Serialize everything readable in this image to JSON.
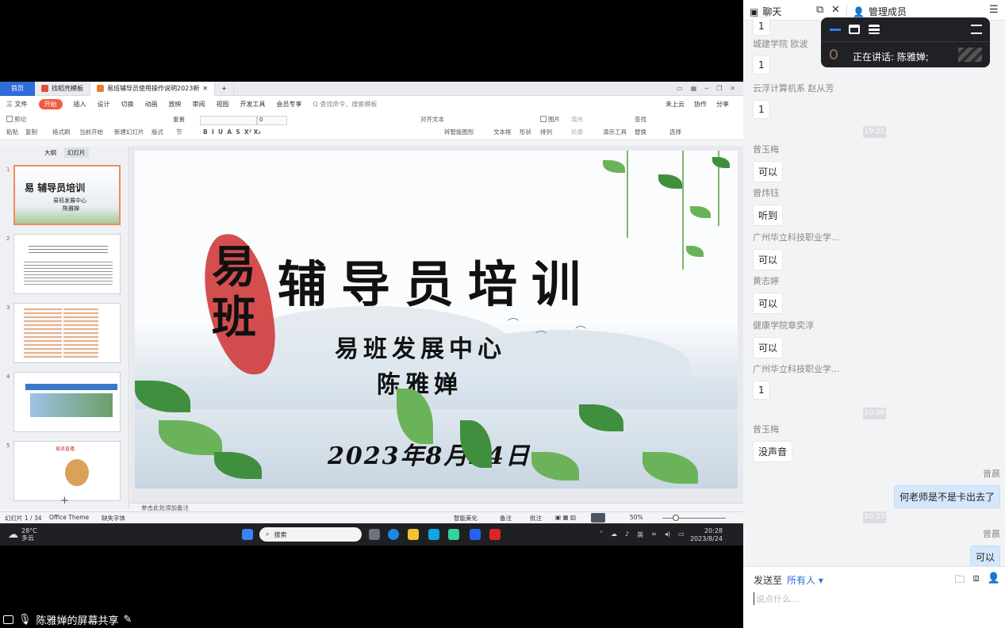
{
  "screen_share": {
    "label": "陈雅婵的屏幕共享",
    "wps": {
      "tabs": [
        "首页",
        "找稻壳模板",
        "易班辅导员使用操作说明2023新"
      ],
      "menu": [
        "三 文件",
        "开始",
        "插入",
        "设计",
        "切换",
        "动画",
        "放映",
        "审阅",
        "视图",
        "开发工具",
        "会员专享",
        "Q 查找命令、搜索模板"
      ],
      "menu_right": [
        "未上云",
        "协作",
        "分享"
      ],
      "ribbon": {
        "cut": "剪切",
        "paste": "粘贴",
        "copy": "复制",
        "painter": "格式刷",
        "play": "当前开始",
        "new_slide": "新建幻灯片",
        "layout": "版式",
        "section": "节",
        "reset": "重置",
        "font_size": "0",
        "align_text": "对齐文本",
        "smartart": "转智能图形",
        "textbox": "文本框",
        "shape": "形状",
        "picture": "图片",
        "arrange": "排列",
        "fill": "填充",
        "outline": "轮廓",
        "present": "演示工具",
        "find": "查找",
        "replace": "替换",
        "select": "选择"
      },
      "pane_tabs": [
        "大纲",
        "幻灯片"
      ],
      "thumb_numbers": [
        "1",
        "2",
        "3",
        "4",
        "5"
      ],
      "thumb_texts": {
        "t1_title": "易 辅导员培训",
        "t1_sub": "易班发展中心",
        "t1_name": "陈雅婵",
        "t5_title": "易班直播"
      },
      "slide": {
        "ban": "易 班",
        "title": "辅导员培训",
        "sub1": "易班发展中心",
        "sub2": "陈雅婵",
        "date": "2023年8月24日"
      },
      "notes_placeholder": "单击此处添加备注",
      "status": {
        "slide_count": "幻灯片 1 / 34",
        "theme": "Office Theme",
        "missing_font": "缺失字体",
        "beautify": "智能美化",
        "notes": "备注",
        "comments": "批注",
        "zoom": "50%"
      }
    },
    "taskbar": {
      "temp": "28°C",
      "weather": "多云",
      "search": "搜索",
      "lang": "英",
      "time": "20:28",
      "date": "2023/8/24"
    }
  },
  "chat": {
    "tab_chat": "聊天",
    "tab_members": "管理成员",
    "messages": [
      {
        "kind": "in",
        "name": "",
        "text": "1"
      },
      {
        "kind": "in",
        "name": "城建学院  欧波",
        "text": "1"
      },
      {
        "kind": "in",
        "name": "云浮计算机系  赵从芳",
        "text": "1"
      },
      {
        "kind": "time",
        "text": "19:21"
      },
      {
        "kind": "in",
        "name": "曾玉梅",
        "text": "可以"
      },
      {
        "kind": "in",
        "name": "曾炜钰",
        "text": "听到"
      },
      {
        "kind": "in",
        "name": "广州华立科技职业学...",
        "text": "可以"
      },
      {
        "kind": "in",
        "name": "黄志婷",
        "text": "可以"
      },
      {
        "kind": "in",
        "name": "健康学院章奕淳",
        "text": "可以"
      },
      {
        "kind": "in",
        "name": "广州华立科技职业学...",
        "text": "1"
      },
      {
        "kind": "time",
        "text": "20:06"
      },
      {
        "kind": "in",
        "name": "曾玉梅",
        "text": "没声音"
      },
      {
        "kind": "out",
        "name": "曾晨",
        "text": "何老师是不是卡出去了"
      },
      {
        "kind": "time",
        "text": "20:27"
      },
      {
        "kind": "out",
        "name": "曾晨",
        "text": "可以"
      }
    ],
    "send_to_label": "发送至",
    "send_to_value": "所有人",
    "input_placeholder": "说点什么..."
  },
  "floating_panel": {
    "speaking_label": "正在讲话: 陈雅婵;"
  },
  "colors": {
    "accent": "#2d6cdf",
    "wps_start": "#ef5b3c",
    "out_bubble": "#d4e7fb",
    "splash_red": "#cf3b3b"
  }
}
